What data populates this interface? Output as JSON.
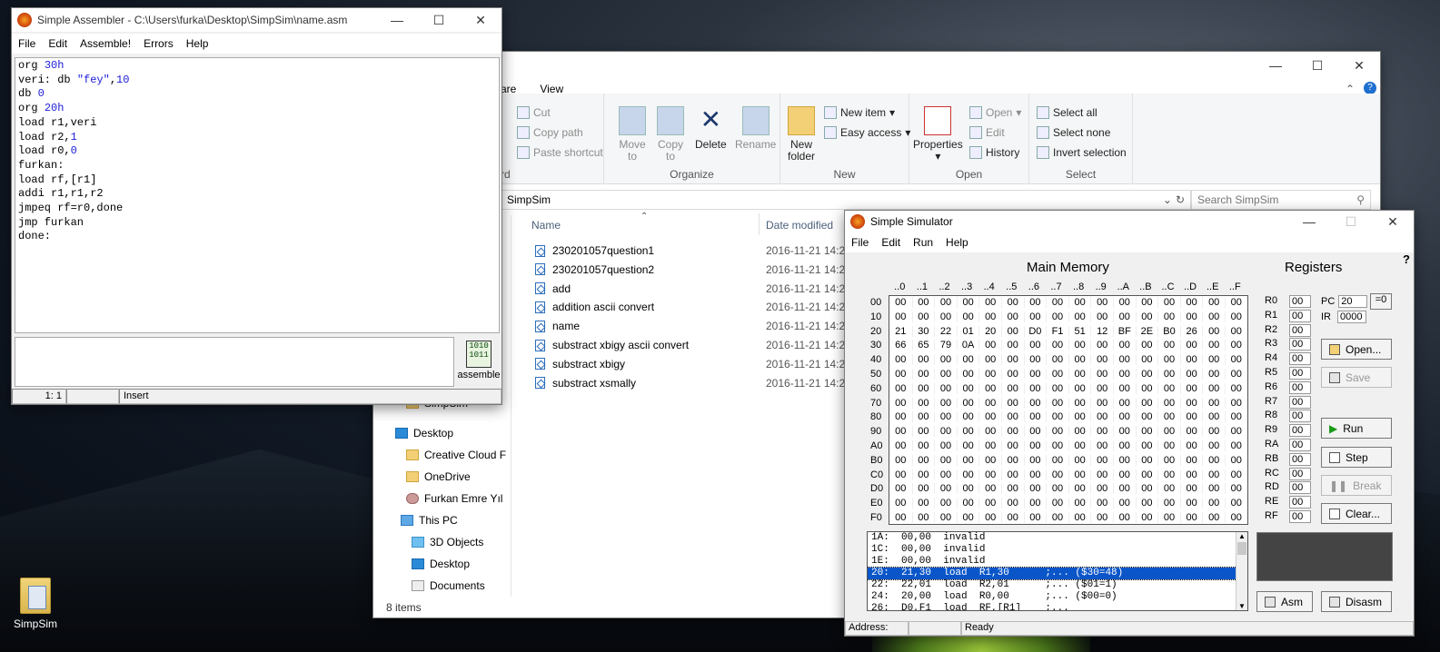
{
  "desktop": {
    "icon_label": "SimpSim"
  },
  "assembler": {
    "title": "Simple Assembler - C:\\Users\\furka\\Desktop\\SimpSim\\name.asm",
    "menu": [
      "File",
      "Edit",
      "Assemble!",
      "Errors",
      "Help"
    ],
    "code_lines": [
      "org 30h",
      "veri: db \"fey\",10",
      "db 0",
      "org 20h",
      "load r1,veri",
      "load r2,1",
      "load r0,0",
      "furkan:",
      "load rf,[r1]",
      "addi r1,r1,r2",
      "jmpeq rf=r0,done",
      "jmp furkan",
      "done:"
    ],
    "assemble_label": "assemble",
    "status_pos": "1: 1",
    "status_mode": "Insert"
  },
  "explorer": {
    "title_suffix": "m",
    "tab_view": "View",
    "tab_share_partial": "are",
    "clipboard_partial": "rd",
    "clipboard_items": [
      "Cut",
      "Copy path",
      "Paste shortcut"
    ],
    "organize": {
      "move": "Move",
      "move2": "to",
      "copy": "Copy",
      "copy2": "to",
      "delete": "Delete",
      "rename": "Rename",
      "label": "Organize"
    },
    "new": {
      "folder": "New",
      "folder2": "folder",
      "new_item": "New item",
      "easy_access": "Easy access",
      "label": "New"
    },
    "open": {
      "properties": "Properties",
      "open": "Open",
      "edit": "Edit",
      "history": "History",
      "label": "Open"
    },
    "select": {
      "all": "Select all",
      "none": "Select none",
      "invert": "Invert selection",
      "label": "Select"
    },
    "address": "SimpSim",
    "search_placeholder": "Search SimpSim",
    "col_name": "Name",
    "col_date": "Date modified",
    "files": [
      {
        "name": "230201057question1",
        "date": "2016-11-21 14:26"
      },
      {
        "name": "230201057question2",
        "date": "2016-11-21 14:26"
      },
      {
        "name": "add",
        "date": "2016-11-21 14:26"
      },
      {
        "name": "addition ascii convert",
        "date": "2016-11-21 14:26"
      },
      {
        "name": "name",
        "date": "2016-11-21 14:26"
      },
      {
        "name": "substract xbigy ascii convert",
        "date": "2016-11-21 14:26"
      },
      {
        "name": "substract xbigy",
        "date": "2016-11-21 14:26"
      },
      {
        "name": "substract xsmally",
        "date": "2016-11-21 14:26"
      }
    ],
    "nav": [
      "SimpSim",
      "Desktop",
      "Creative Cloud F",
      "OneDrive",
      "Furkan Emre Yıl",
      "This PC",
      "3D Objects",
      "Desktop",
      "Documents"
    ],
    "status": "8 items"
  },
  "simulator": {
    "title": "Simple Simulator",
    "menu": [
      "File",
      "Edit",
      "Run",
      "Help"
    ],
    "help_glyph": "?",
    "mem_title": "Main Memory",
    "reg_title": "Registers",
    "col_headers": [
      "..0",
      "..1",
      "..2",
      "..3",
      "..4",
      "..5",
      "..6",
      "..7",
      "..8",
      "..9",
      "..A",
      "..B",
      "..C",
      "..D",
      "..E",
      "..F"
    ],
    "row_labels": [
      "00",
      "10",
      "20",
      "30",
      "40",
      "50",
      "60",
      "70",
      "80",
      "90",
      "A0",
      "B0",
      "C0",
      "D0",
      "E0",
      "F0"
    ],
    "row20": [
      "21",
      "30",
      "22",
      "01",
      "20",
      "00",
      "D0",
      "F1",
      "51",
      "12",
      "BF",
      "2E",
      "B0",
      "26",
      "00",
      "00"
    ],
    "row30": [
      "66",
      "65",
      "79",
      "0A",
      "00",
      "00",
      "00",
      "00",
      "00",
      "00",
      "00",
      "00",
      "00",
      "00",
      "00",
      "00"
    ],
    "zero": "00",
    "registers": [
      "R0",
      "R1",
      "R2",
      "R3",
      "R4",
      "R5",
      "R6",
      "R7",
      "R8",
      "R9",
      "RA",
      "RB",
      "RC",
      "RD",
      "RE",
      "RF"
    ],
    "pc_label": "PC",
    "pc_value": "20",
    "ir_label": "IR",
    "ir_value": "0000",
    "eq0": "=0",
    "buttons": {
      "open": "Open...",
      "save": "Save",
      "run": "Run",
      "step": "Step",
      "break": "Break",
      "clear": "Clear...",
      "asm": "Asm",
      "disasm": "Disasm"
    },
    "disasm_lines": [
      "1A:  00,00  invalid",
      "1C:  00,00  invalid",
      "1E:  00,00  invalid",
      "20:  21,30  load  R1,30      ;... ($30=48)",
      "22:  22,01  load  R2,01      ;... ($01=1)",
      "24:  20,00  load  R0,00      ;... ($00=0)",
      "26:  D0,F1  load  RF,[R1]    ;..."
    ],
    "status_address": "Address:",
    "status_ready": "Ready"
  }
}
